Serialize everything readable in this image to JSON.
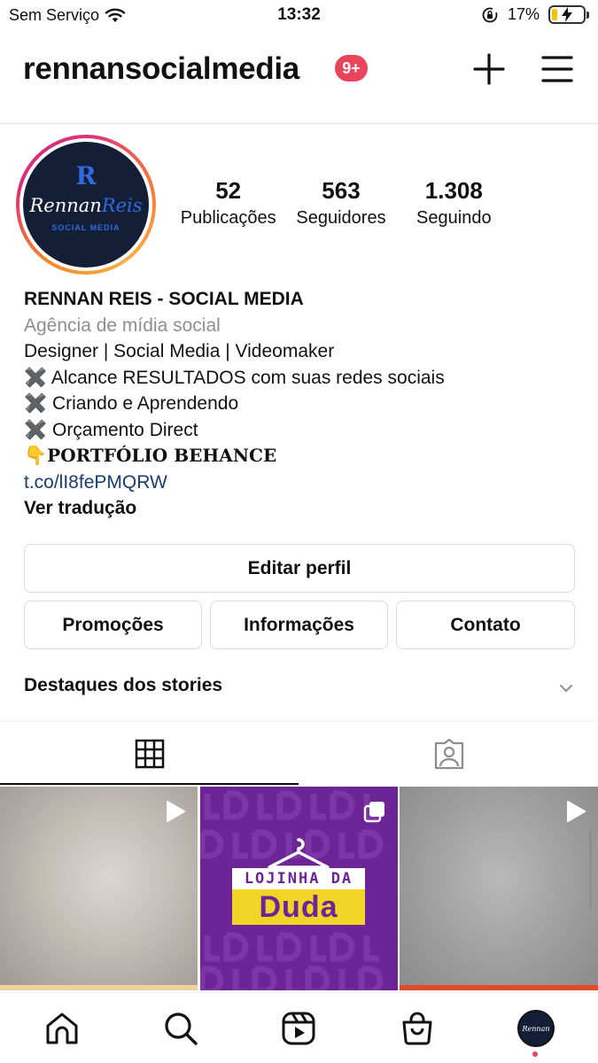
{
  "status_bar": {
    "carrier": "Sem Serviço",
    "time": "13:32",
    "battery_percent": "17%",
    "battery_level": 0.17
  },
  "header": {
    "username": "rennansocialmedia",
    "notification_badge": "9+"
  },
  "profile": {
    "avatar": {
      "brand_mark": "R",
      "brand_first": "Rennan",
      "brand_last": "Reis",
      "brand_sub": "SOCIAL MEDIA"
    },
    "stats": [
      {
        "value": "52",
        "label": "Publicações"
      },
      {
        "value": "563",
        "label": "Seguidores"
      },
      {
        "value": "1.308",
        "label": "Seguindo"
      }
    ],
    "bio": {
      "name": "RENNAN REIS - SOCIAL MEDIA",
      "category": "Agência de mídia social",
      "lines": [
        "Designer | Social Media | Videomaker",
        "✖️ Alcance RESULTADOS com suas redes sociais",
        "✖️ Criando e Aprendendo",
        "✖️ Orçamento Direct"
      ],
      "portfolio_emoji": "👇",
      "portfolio": "PORTFÓLIO BEHANCE",
      "link": "t.co/lI8fePMQRW",
      "translate": "Ver tradução"
    }
  },
  "buttons": {
    "edit_profile": "Editar perfil",
    "promotions": "Promoções",
    "info": "Informações",
    "contact": "Contato"
  },
  "highlights_title": "Destaques dos stories",
  "grid": {
    "post2_top": "LOJINHA DA",
    "post2_main": "Duda"
  },
  "colors": {
    "badge": "#e94459",
    "link": "#1a3c6e",
    "post_purple": "#6c2496",
    "post_yellow": "#f2d426"
  }
}
